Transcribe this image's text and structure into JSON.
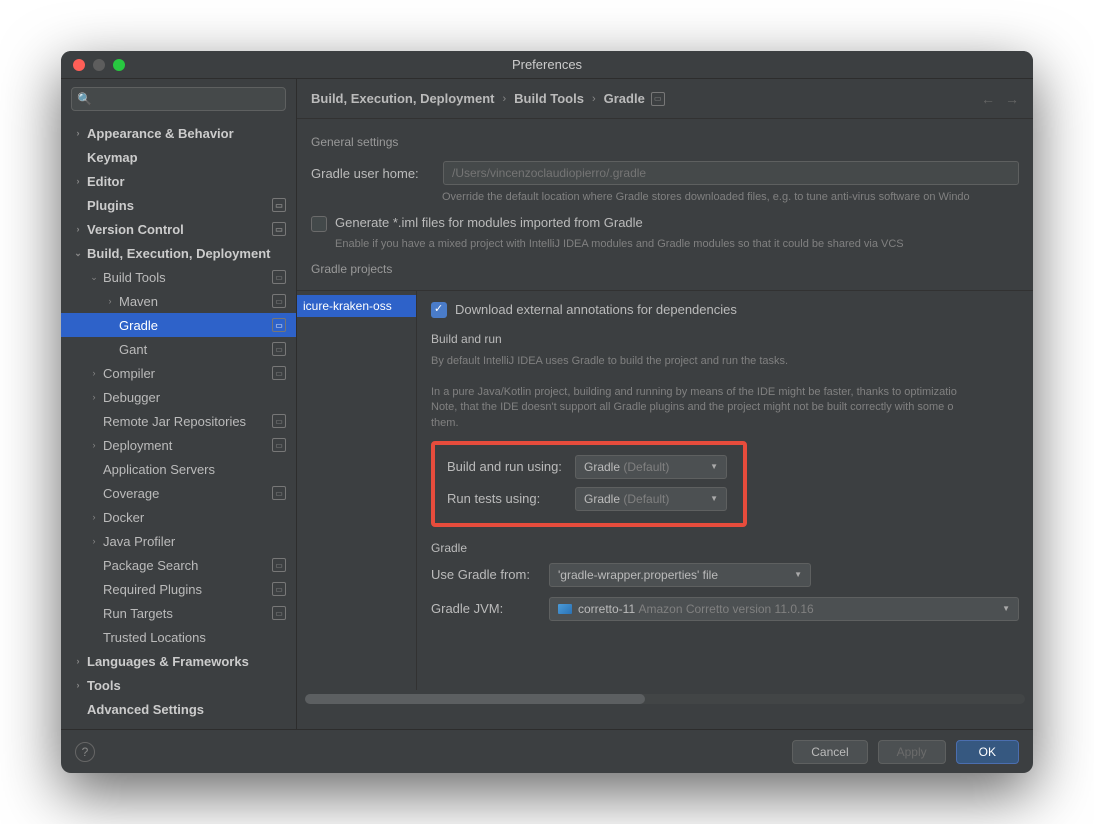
{
  "window": {
    "title": "Preferences"
  },
  "search": {
    "placeholder": ""
  },
  "sidebar": {
    "items": [
      {
        "label": "Appearance & Behavior",
        "level": 0,
        "arrow": "›",
        "bold": true
      },
      {
        "label": "Keymap",
        "level": 0,
        "bold": true
      },
      {
        "label": "Editor",
        "level": 0,
        "arrow": "›",
        "bold": true
      },
      {
        "label": "Plugins",
        "level": 0,
        "bold": true,
        "tag": true
      },
      {
        "label": "Version Control",
        "level": 0,
        "arrow": "›",
        "bold": true,
        "tag": true
      },
      {
        "label": "Build, Execution, Deployment",
        "level": 0,
        "arrow": "⌄",
        "bold": true
      },
      {
        "label": "Build Tools",
        "level": 1,
        "arrow": "⌄",
        "tag": true
      },
      {
        "label": "Maven",
        "level": 2,
        "arrow": "›",
        "tag": true
      },
      {
        "label": "Gradle",
        "level": 2,
        "tag": true,
        "selected": true
      },
      {
        "label": "Gant",
        "level": 2,
        "tag": true
      },
      {
        "label": "Compiler",
        "level": 1,
        "arrow": "›",
        "tag": true
      },
      {
        "label": "Debugger",
        "level": 1,
        "arrow": "›"
      },
      {
        "label": "Remote Jar Repositories",
        "level": 1,
        "tag": true
      },
      {
        "label": "Deployment",
        "level": 1,
        "arrow": "›",
        "tag": true
      },
      {
        "label": "Application Servers",
        "level": 1
      },
      {
        "label": "Coverage",
        "level": 1,
        "tag": true
      },
      {
        "label": "Docker",
        "level": 1,
        "arrow": "›"
      },
      {
        "label": "Java Profiler",
        "level": 1,
        "arrow": "›"
      },
      {
        "label": "Package Search",
        "level": 1,
        "tag": true
      },
      {
        "label": "Required Plugins",
        "level": 1,
        "tag": true
      },
      {
        "label": "Run Targets",
        "level": 1,
        "tag": true
      },
      {
        "label": "Trusted Locations",
        "level": 1
      },
      {
        "label": "Languages & Frameworks",
        "level": 0,
        "arrow": "›",
        "bold": true
      },
      {
        "label": "Tools",
        "level": 0,
        "arrow": "›",
        "bold": true
      },
      {
        "label": "Advanced Settings",
        "level": 0,
        "bold": true
      }
    ]
  },
  "breadcrumb": {
    "a": "Build, Execution, Deployment",
    "b": "Build Tools",
    "c": "Gradle"
  },
  "general": {
    "title": "General settings",
    "user_home_label": "Gradle user home:",
    "user_home_placeholder": "/Users/vincenzoclaudiopierro/.gradle",
    "user_home_hint": "Override the default location where Gradle stores downloaded files, e.g. to tune anti-virus software on Windo",
    "gen_iml_label": "Generate *.iml files for modules imported from Gradle",
    "gen_iml_hint": "Enable if you have a mixed project with IntelliJ IDEA modules and Gradle modules so that it could be shared via VCS"
  },
  "projects": {
    "title": "Gradle projects",
    "list": [
      {
        "name": "icure-kraken-oss",
        "selected": true
      }
    ],
    "download_label": "Download external annotations for dependencies",
    "build_run": {
      "title": "Build and run",
      "desc1": "By default IntelliJ IDEA uses Gradle to build the project and run the tasks.",
      "desc2": "In a pure Java/Kotlin project, building and running by means of the IDE might be faster, thanks to optimizatio",
      "desc3": "Note, that the IDE doesn't support all Gradle plugins and the project might not be built correctly with some o",
      "desc4": "them.",
      "build_label": "Build and run using:",
      "tests_label": "Run tests using:",
      "value_main": "Gradle",
      "value_suffix": "(Default)"
    },
    "gradle_group": {
      "title": "Gradle",
      "use_from_label": "Use Gradle from:",
      "use_from_value": "'gradle-wrapper.properties' file",
      "jvm_label": "Gradle JVM:",
      "jvm_value": "corretto-11",
      "jvm_suffix": "Amazon Corretto version 11.0.16"
    }
  },
  "footer": {
    "cancel": "Cancel",
    "apply": "Apply",
    "ok": "OK"
  }
}
